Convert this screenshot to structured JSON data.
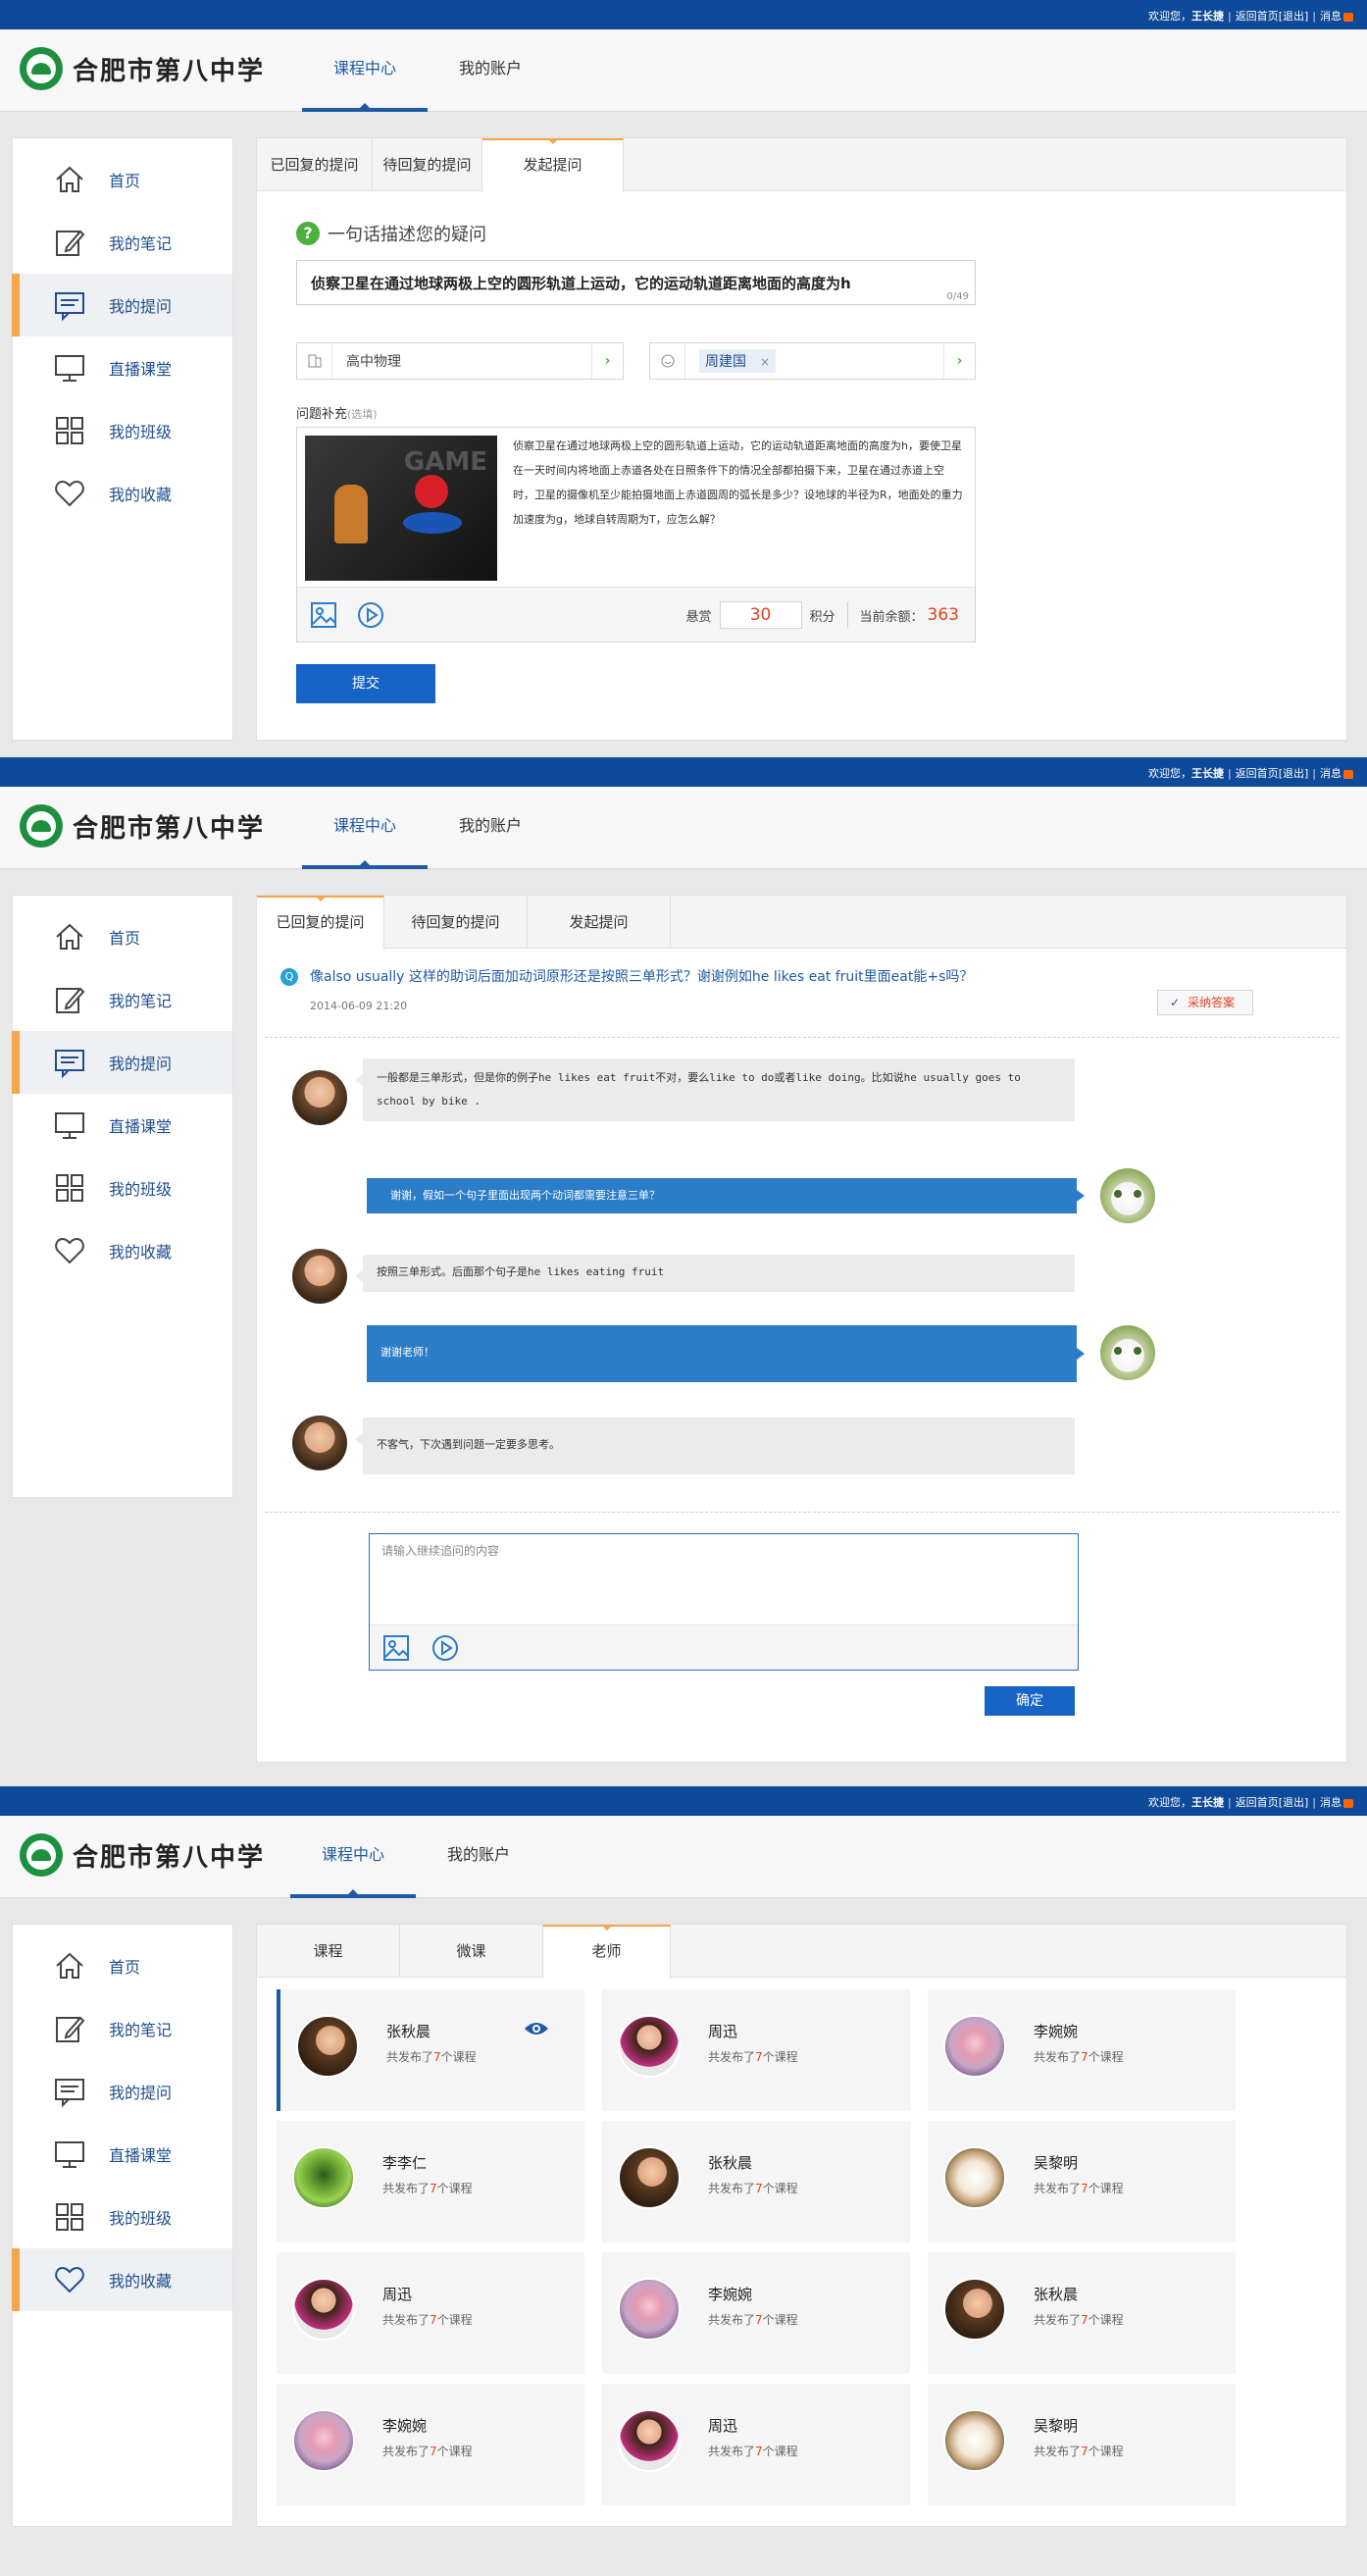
{
  "topbar": {
    "greeting": "欢迎您，",
    "username": "王长捷",
    "home_link": "返回首页",
    "logout": "[退出]",
    "messages": "消息"
  },
  "header": {
    "school_name": "合肥市第八中学",
    "nav": [
      {
        "label": "课程中心",
        "active": true
      },
      {
        "label": "我的账户",
        "active": false
      }
    ]
  },
  "sidebar": {
    "items": [
      {
        "label": "首页",
        "icon": "home-icon"
      },
      {
        "label": "我的笔记",
        "icon": "edit-note-icon"
      },
      {
        "label": "我的提问",
        "icon": "question-message-icon"
      },
      {
        "label": "直播课堂",
        "icon": "monitor-icon"
      },
      {
        "label": "我的班级",
        "icon": "grid-class-icon"
      },
      {
        "label": "我的收藏",
        "icon": "heart-icon"
      }
    ]
  },
  "ask": {
    "tabs": [
      "已回复的提问",
      "待回复的提问",
      "发起提问"
    ],
    "active_tab": 2,
    "title": "一句话描述您的疑问",
    "question": "侦察卫星在通过地球两极上空的圆形轨道上运动，它的运动轨道距离地面的高度为h",
    "char_count": "0/49",
    "subject": "高中物理",
    "teacher_tag": "周建国",
    "supp_label": "问题补充",
    "supp_optional": "(选填)",
    "image_caption": "GAME",
    "supp_text": "侦察卫星在通过地球两极上空的圆形轨道上运动，它的运动轨道距离地面的高度为h，要使卫星在一天时间内将地面上赤道各处在日照条件下的情况全部都拍摄下来，卫星在通过赤道上空时，卫星的摄像机至少能拍摄地面上赤道圆周的弧长是多少？设地球的半径为R，地面处的重力加速度为g，地球自转周期为T，应怎么解？",
    "reward_label": "悬赏",
    "reward_value": "30",
    "points_label": "积分",
    "balance_label": "当前余额：",
    "balance_value": "363",
    "submit": "提交"
  },
  "conversation": {
    "tabs": [
      "已回复的提问",
      "待回复的提问",
      "发起提问"
    ],
    "active_tab": 0,
    "question_title": "像also usually 这样的助词后面加动词原形还是按照三单形式？谢谢例如he likes eat fruit里面eat能+s吗？",
    "question_date": "2014-06-09 21:20",
    "accept_label": "采纳答案",
    "messages": [
      {
        "side": "left",
        "text": "一般都是三单形式，但是你的例子he likes eat fruit不对，要么like to do或者like doing。比如说he usually goes to school by bike ."
      },
      {
        "side": "right",
        "text": "谢谢，假如一个句子里面出现两个动词都需要注意三单？"
      },
      {
        "side": "left",
        "text": "按照三单形式。后面那个句子是he likes eating fruit"
      },
      {
        "side": "right",
        "text": "谢谢老师！"
      },
      {
        "side": "left",
        "text": "不客气，下次遇到问题一定要多思考。"
      }
    ],
    "reply_placeholder": "请输入继续追问的内容",
    "confirm": "确定"
  },
  "favorites": {
    "tabs": [
      "课程",
      "微课",
      "老师"
    ],
    "active_tab": 2,
    "sub_prefix": "共发布了",
    "sub_count": "7",
    "sub_suffix": "个课程",
    "teachers": [
      {
        "name": "张秋晨",
        "avatar": "zqc",
        "selected": true
      },
      {
        "name": "周迅",
        "avatar": "zx"
      },
      {
        "name": "李婉婉",
        "avatar": "lww"
      },
      {
        "name": "李李仁",
        "avatar": "llr"
      },
      {
        "name": "张秋晨",
        "avatar": "zqc"
      },
      {
        "name": "吴黎明",
        "avatar": "wlm"
      },
      {
        "name": "周迅",
        "avatar": "zx"
      },
      {
        "name": "李婉婉",
        "avatar": "lww"
      },
      {
        "name": "张秋晨",
        "avatar": "zqc"
      },
      {
        "name": "李婉婉",
        "avatar": "lww"
      },
      {
        "name": "周迅",
        "avatar": "zx"
      },
      {
        "name": "吴黎明",
        "avatar": "wlm"
      }
    ]
  },
  "colors": {
    "topbar": "#0e4a9a",
    "accent_orange": "#f5a54a",
    "link_blue": "#1f4e8f",
    "button_blue": "#1664c5",
    "highlight_red": "#e2421f"
  }
}
